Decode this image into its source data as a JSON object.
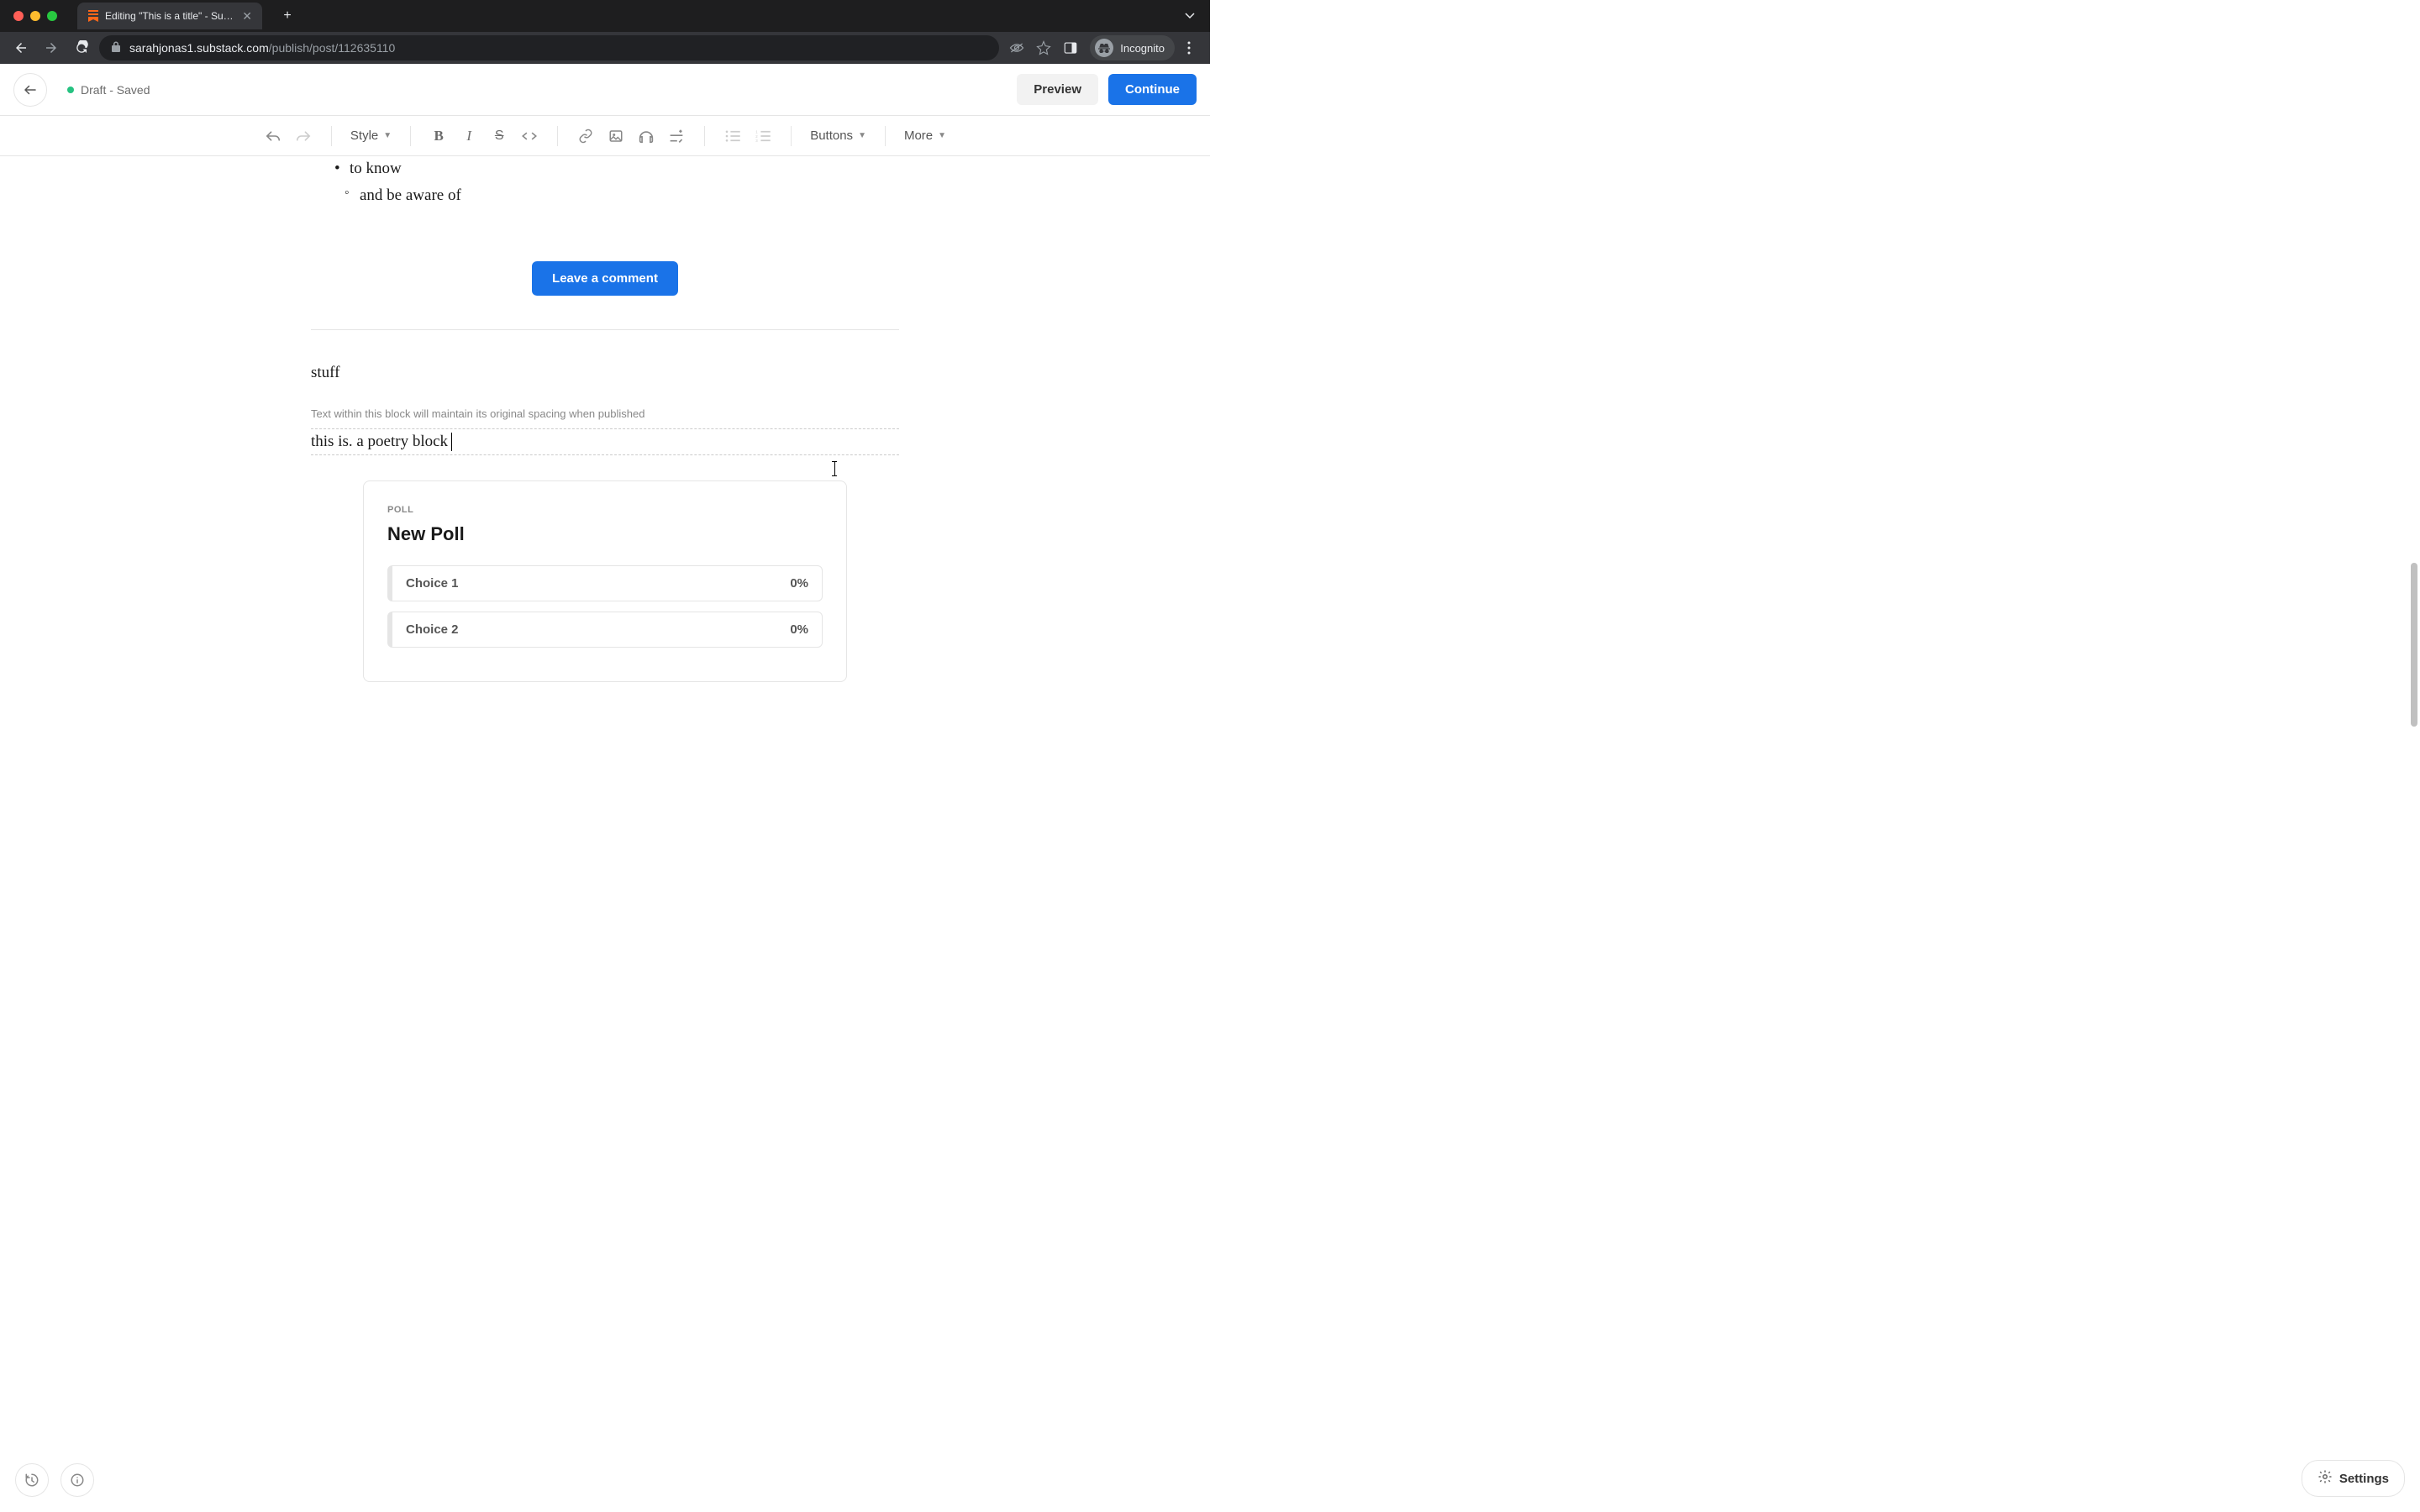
{
  "browser": {
    "tab_title": "Editing \"This is a title\" - Subst...",
    "url": "sarahjonas1.substack.com/publish/post/112635110",
    "url_host": "sarahjonas1.substack.com",
    "url_path": "/publish/post/112635110",
    "incognito_label": "Incognito"
  },
  "header": {
    "status": "Draft - Saved",
    "preview": "Preview",
    "continue": "Continue"
  },
  "toolbar": {
    "style": "Style",
    "buttons": "Buttons",
    "more": "More"
  },
  "content": {
    "bullet1": "to know",
    "sub_bullet": "and be aware of",
    "comment_btn": "Leave a comment",
    "stuff_text": "stuff",
    "poetry_note": "Text within this block will maintain its original spacing when published",
    "poetry_text": "this is. a poetry block"
  },
  "poll": {
    "label": "POLL",
    "title": "New Poll",
    "choices": [
      {
        "label": "Choice 1",
        "pct": "0%"
      },
      {
        "label": "Choice 2",
        "pct": "0%"
      }
    ]
  },
  "footer": {
    "settings": "Settings"
  }
}
